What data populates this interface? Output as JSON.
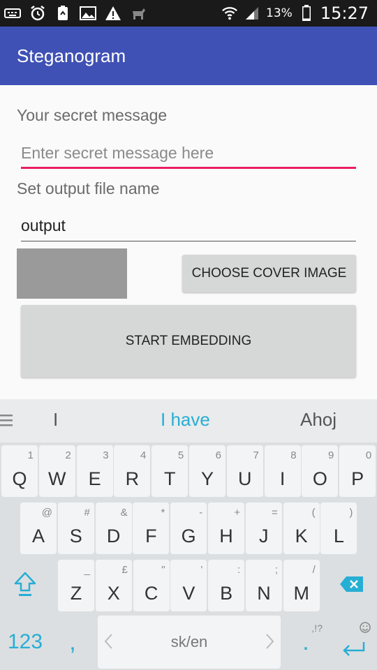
{
  "status_bar": {
    "battery_percent": "13%",
    "time": "15:27",
    "icons": [
      "keyboard-icon",
      "alarm-icon",
      "battery-saver-icon",
      "image-icon",
      "warning-icon",
      "animal-icon",
      "wifi-icon",
      "signal-icon",
      "battery-icon"
    ]
  },
  "app": {
    "title": "Steganogram",
    "accent": "#3f51b5",
    "input_focus_color": "#e91e63"
  },
  "form": {
    "secret_label": "Your secret message",
    "secret_placeholder": "Enter secret message here",
    "output_label": "Set output file name",
    "output_value": "output",
    "choose_button": "CHOOSE COVER IMAGE",
    "start_button": "START EMBEDDING"
  },
  "keyboard": {
    "suggestions": [
      "I",
      "I have",
      "Ahoj"
    ],
    "row1": [
      [
        "Q",
        "1"
      ],
      [
        "W",
        "2"
      ],
      [
        "E",
        "3"
      ],
      [
        "R",
        "4"
      ],
      [
        "T",
        "5"
      ],
      [
        "Y",
        "6"
      ],
      [
        "U",
        "7"
      ],
      [
        "I",
        "8"
      ],
      [
        "O",
        "9"
      ],
      [
        "P",
        "0"
      ]
    ],
    "row2": [
      [
        "A",
        "@"
      ],
      [
        "S",
        "#"
      ],
      [
        "D",
        "&"
      ],
      [
        "F",
        "*"
      ],
      [
        "G",
        "-"
      ],
      [
        "H",
        "+"
      ],
      [
        "J",
        "="
      ],
      [
        "K",
        "("
      ],
      [
        "L",
        ")"
      ]
    ],
    "row3": [
      [
        "Z",
        "_"
      ],
      [
        "X",
        "£"
      ],
      [
        "C",
        "\""
      ],
      [
        "V",
        "'"
      ],
      [
        "B",
        ":"
      ],
      [
        "N",
        ";"
      ],
      [
        "M",
        "/"
      ]
    ],
    "num_key": "123",
    "comma_key": ",",
    "space_label": "sk/en",
    "period_key": ".",
    "period_sub": ",!?",
    "accent": "#27aed4"
  }
}
